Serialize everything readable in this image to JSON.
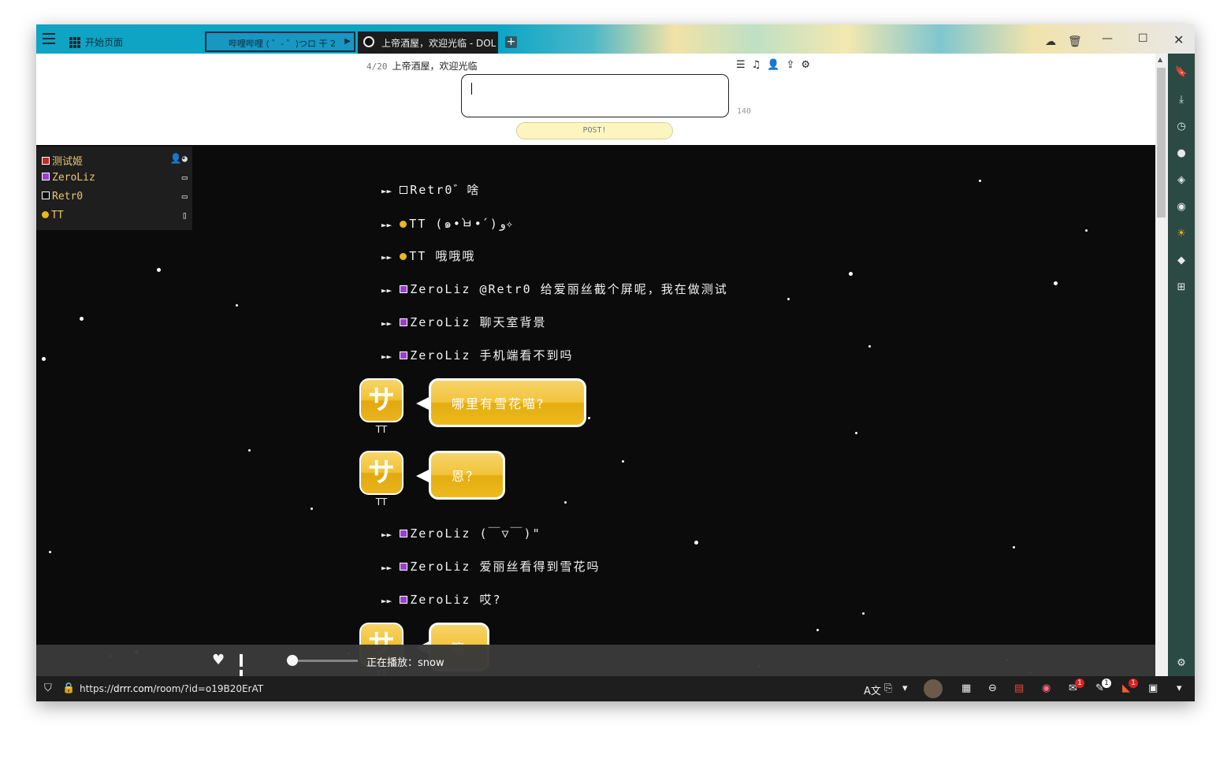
{
  "browser": {
    "start_page_label": "开始页面",
    "tabs": [
      {
        "title": "哔哩哔哩 ( ゜- ゜)つロ 干",
        "count": "2"
      },
      {
        "title": "上帝酒屋，欢迎光临 - DOL"
      }
    ],
    "url_prefix": "https://",
    "url_domain": "drrr.com",
    "url_path": "/room/?id=o19B20ErAT"
  },
  "room": {
    "count": "4/20",
    "name": "上帝酒屋，欢迎光临",
    "input_value": "",
    "char_limit": "140",
    "post_label": "POST!"
  },
  "users": [
    {
      "name": "测试姬",
      "marker": "square",
      "color": "#c62828"
    },
    {
      "name": "ZeroLiz",
      "marker": "square",
      "color": "#9c3fcf"
    },
    {
      "name": "Retr0",
      "marker": "square",
      "color": "#0b0b0b"
    },
    {
      "name": "TT",
      "marker": "dot",
      "color": "#e8b820"
    }
  ],
  "messages": [
    {
      "type": "action",
      "arrow": "►►",
      "user": "Retr0",
      "text": "゛啥",
      "marker": "square",
      "color": "#0b0b0b"
    },
    {
      "type": "action",
      "arrow": "►►",
      "user": "TT",
      "text": " (๑•̀ㅂ•́)و✧",
      "marker": "dot",
      "color": "#e8b820"
    },
    {
      "type": "action",
      "arrow": "►►",
      "user": "TT",
      "text": " 哦哦哦",
      "marker": "dot",
      "color": "#e8b820"
    },
    {
      "type": "action",
      "arrow": "►►",
      "user": "ZeroLiz",
      "text": " @Retr0 给爱丽丝截个屏呢，我在做测试",
      "marker": "square",
      "color": "#9c3fcf"
    },
    {
      "type": "action",
      "arrow": "►►",
      "user": "ZeroLiz",
      "text": " 聊天室背景",
      "marker": "square",
      "color": "#9c3fcf"
    },
    {
      "type": "action",
      "arrow": "►►",
      "user": "ZeroLiz",
      "text": " 手机端看不到吗",
      "marker": "square",
      "color": "#9c3fcf"
    },
    {
      "type": "bubble",
      "user": "TT",
      "avatar_char": "サ",
      "text": "哪里有雪花喵?"
    },
    {
      "type": "bubble",
      "user": "TT",
      "avatar_char": "サ",
      "text": "恩？"
    },
    {
      "type": "action",
      "arrow": "►►",
      "user": "ZeroLiz",
      "text": " (￣▽￣)\"",
      "marker": "square",
      "color": "#9c3fcf"
    },
    {
      "type": "action",
      "arrow": "►►",
      "user": "ZeroLiz",
      "text": " 爱丽丝看得到雪花吗",
      "marker": "square",
      "color": "#9c3fcf"
    },
    {
      "type": "action",
      "arrow": "►►",
      "user": "ZeroLiz",
      "text": " 哎?",
      "marker": "square",
      "color": "#9c3fcf"
    },
    {
      "type": "bubble",
      "user": "TT",
      "avatar_char": "サ",
      "text": "噢"
    }
  ],
  "player": {
    "now_playing": "正在播放：snow",
    "progress": 0.0
  },
  "status_badges": [
    "1",
    "1",
    "1"
  ],
  "colors": {
    "chat_background": "#0b0b0b",
    "bubble_yellow": "#f2c43c",
    "side_panel": "#2b4a44"
  }
}
